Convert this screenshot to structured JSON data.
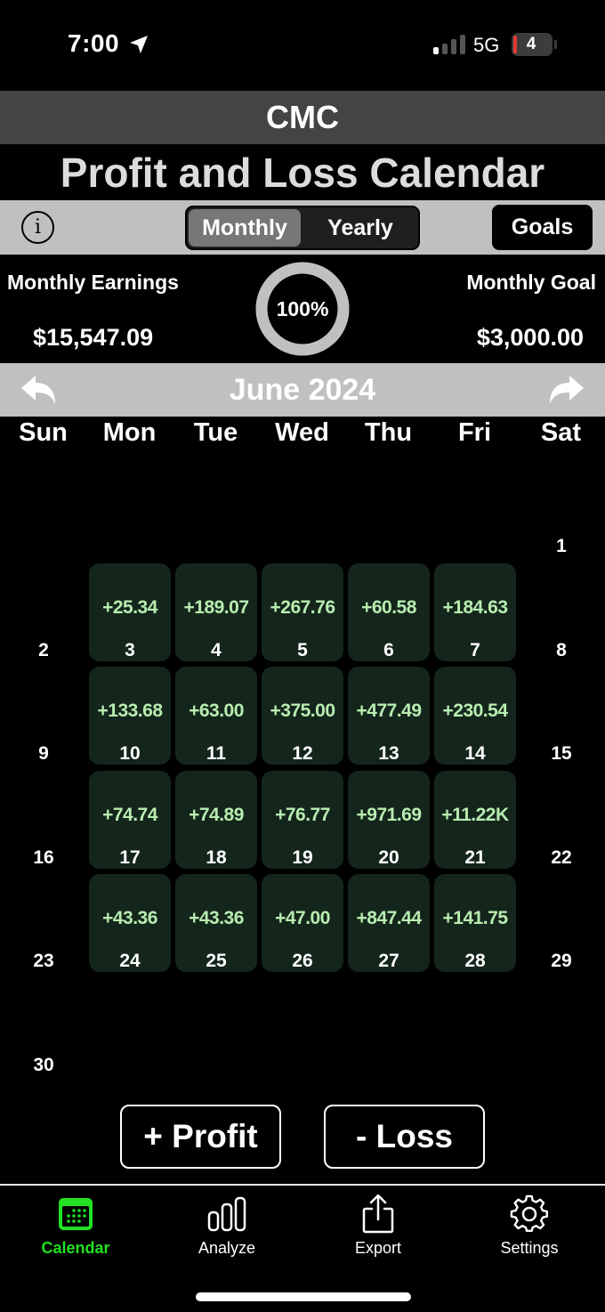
{
  "status_bar": {
    "time": "7:00",
    "network": "5G",
    "battery_level": "4",
    "icons": [
      "location-arrow-icon",
      "signal-bars-icon",
      "battery-icon"
    ]
  },
  "app": {
    "name": "CMC",
    "title": "Profit and Loss Calendar"
  },
  "toolbar": {
    "info_icon": "info-icon",
    "segments": [
      {
        "label": "Monthly",
        "selected": true
      },
      {
        "label": "Yearly",
        "selected": false
      }
    ],
    "goals_label": "Goals"
  },
  "summary": {
    "earnings_label": "Monthly Earnings",
    "earnings_value": "$15,547.09",
    "goal_label": "Monthly Goal",
    "goal_value": "$3,000.00",
    "progress_label": "100%",
    "progress_fraction": 1.0
  },
  "calendar": {
    "month_title": "June 2024",
    "prev_icon": "arrow-back-icon",
    "next_icon": "arrow-forward-icon",
    "weekdays": [
      "Sun",
      "Mon",
      "Tue",
      "Wed",
      "Thu",
      "Fri",
      "Sat"
    ],
    "first_weekday_index": 6,
    "days_in_month": 30,
    "entries": {
      "3": "+25.34",
      "4": "+189.07",
      "5": "+267.76",
      "6": "+60.58",
      "7": "+184.63",
      "10": "+133.68",
      "11": "+63.00",
      "12": "+375.00",
      "13": "+477.49",
      "14": "+230.54",
      "17": "+74.74",
      "18": "+74.89",
      "19": "+76.77",
      "20": "+971.69",
      "21": "+11.22K",
      "24": "+43.36",
      "25": "+43.36",
      "26": "+47.00",
      "27": "+847.44",
      "28": "+141.75"
    },
    "colors": {
      "profit_cell_bg": "#14261c",
      "profit_text": "#b8ecb0"
    }
  },
  "actions": {
    "profit_label": "+ Profit",
    "loss_label": "- Loss"
  },
  "tab_bar": {
    "active_color": "#21e021",
    "tabs": [
      {
        "label": "Calendar",
        "icon": "calendar-icon",
        "active": true
      },
      {
        "label": "Analyze",
        "icon": "bar-chart-icon",
        "active": false
      },
      {
        "label": "Export",
        "icon": "share-icon",
        "active": false
      },
      {
        "label": "Settings",
        "icon": "gear-icon",
        "active": false
      }
    ]
  }
}
